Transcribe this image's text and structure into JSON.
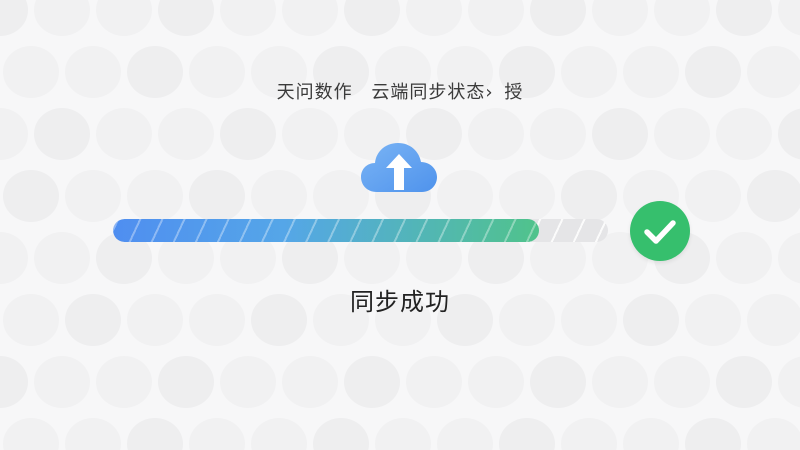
{
  "header": {
    "app_name": "天问数作",
    "section": "云端同步状态",
    "separator": "›",
    "trailing": "授"
  },
  "icons": {
    "upload": "cloud-upload-icon",
    "success": "checkmark-icon"
  },
  "progress": {
    "value": 0.86
  },
  "status": {
    "label": "同步成功"
  },
  "colors": {
    "progress_start": "#4f8ef0",
    "progress_end": "#50c38b",
    "success": "#36bf6d",
    "cloud": "#5aa2f0"
  }
}
